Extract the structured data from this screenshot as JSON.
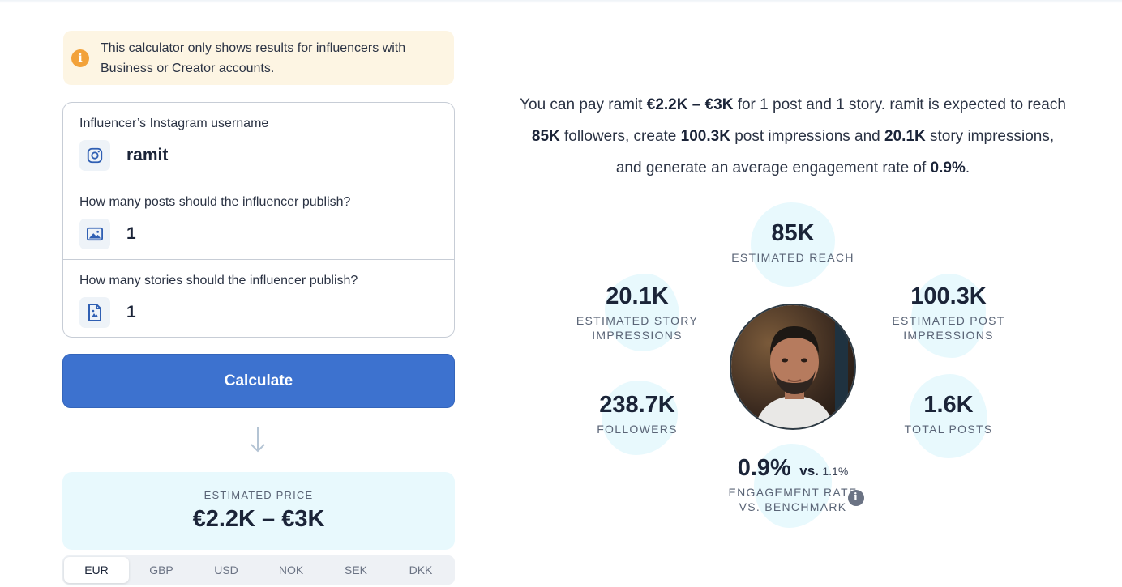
{
  "notice": {
    "text_line1": "This calculator only shows results for influencers with",
    "text_line2": "Business or Creator accounts.",
    "icon": "info-icon"
  },
  "form": {
    "username": {
      "label": "Influencer’s Instagram username",
      "value": "ramit",
      "icon": "instagram-icon"
    },
    "posts": {
      "label": "How many posts should the influencer publish?",
      "value": "1",
      "icon": "image-icon"
    },
    "stories": {
      "label": "How many stories should the influencer publish?",
      "value": "1",
      "icon": "story-file-icon"
    }
  },
  "calculate_label": "Calculate",
  "price": {
    "label": "ESTIMATED PRICE",
    "value": "€2.2K – €3K"
  },
  "currencies": [
    "EUR",
    "GBP",
    "USD",
    "NOK",
    "SEK",
    "DKK"
  ],
  "active_currency": "EUR",
  "summary": {
    "p1": "You can pay ramit ",
    "price": "€2.2K – €3K",
    "p2": " for 1 post and 1 story. ramit is expected to reach",
    "reach": "85K",
    "p3": " followers, create ",
    "post_impr": "100.3K",
    "p4": " post impressions and ",
    "story_impr": "20.1K",
    "p5": " story impressions,",
    "p6": "and generate an average engagement rate of ",
    "engagement": "0.9%",
    "p7": "."
  },
  "stats": {
    "reach": {
      "value": "85K",
      "label": "ESTIMATED REACH"
    },
    "story": {
      "value": "20.1K",
      "label_line1": "ESTIMATED STORY",
      "label_line2": "IMPRESSIONS"
    },
    "post": {
      "value": "100.3K",
      "label_line1": "ESTIMATED POST",
      "label_line2": "IMPRESSIONS"
    },
    "followers": {
      "value": "238.7K",
      "label": "FOLLOWERS"
    },
    "total_posts": {
      "value": "1.6K",
      "label": "TOTAL POSTS"
    },
    "engagement": {
      "value": "0.9%",
      "vs": "vs.",
      "benchmark": "1.1%",
      "label_line1": "ENGAGEMENT RATE",
      "label_line2": "VS. BENCHMARK"
    }
  },
  "colors": {
    "primary": "#3d72cf",
    "light_bg": "#e8f9fd",
    "notice_bg": "#fdf5e3",
    "notice_icon": "#f2a23a"
  }
}
